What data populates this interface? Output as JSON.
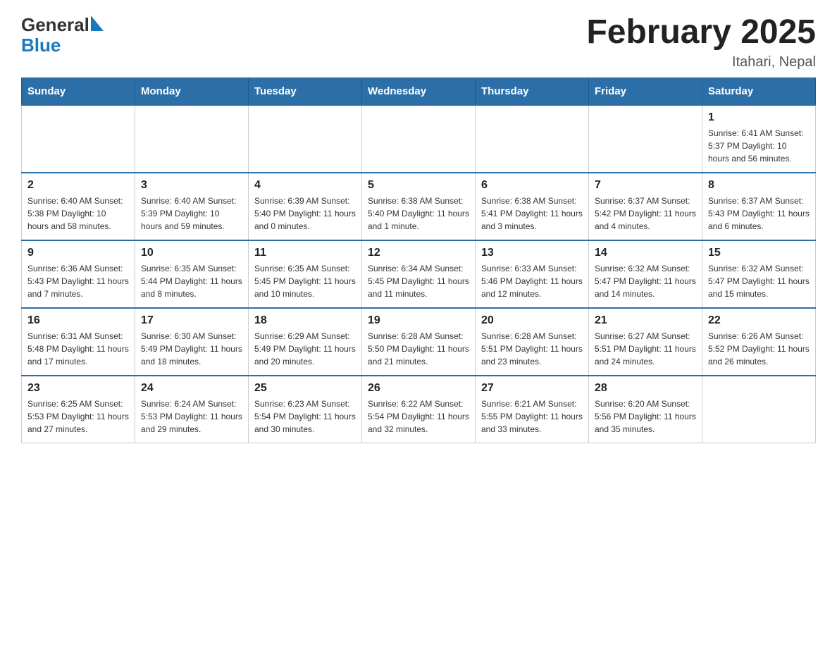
{
  "header": {
    "logo_general": "General",
    "logo_blue": "Blue",
    "title": "February 2025",
    "subtitle": "Itahari, Nepal"
  },
  "days_of_week": [
    "Sunday",
    "Monday",
    "Tuesday",
    "Wednesday",
    "Thursday",
    "Friday",
    "Saturday"
  ],
  "weeks": [
    [
      {
        "day": "",
        "info": ""
      },
      {
        "day": "",
        "info": ""
      },
      {
        "day": "",
        "info": ""
      },
      {
        "day": "",
        "info": ""
      },
      {
        "day": "",
        "info": ""
      },
      {
        "day": "",
        "info": ""
      },
      {
        "day": "1",
        "info": "Sunrise: 6:41 AM\nSunset: 5:37 PM\nDaylight: 10 hours\nand 56 minutes."
      }
    ],
    [
      {
        "day": "2",
        "info": "Sunrise: 6:40 AM\nSunset: 5:38 PM\nDaylight: 10 hours\nand 58 minutes."
      },
      {
        "day": "3",
        "info": "Sunrise: 6:40 AM\nSunset: 5:39 PM\nDaylight: 10 hours\nand 59 minutes."
      },
      {
        "day": "4",
        "info": "Sunrise: 6:39 AM\nSunset: 5:40 PM\nDaylight: 11 hours\nand 0 minutes."
      },
      {
        "day": "5",
        "info": "Sunrise: 6:38 AM\nSunset: 5:40 PM\nDaylight: 11 hours\nand 1 minute."
      },
      {
        "day": "6",
        "info": "Sunrise: 6:38 AM\nSunset: 5:41 PM\nDaylight: 11 hours\nand 3 minutes."
      },
      {
        "day": "7",
        "info": "Sunrise: 6:37 AM\nSunset: 5:42 PM\nDaylight: 11 hours\nand 4 minutes."
      },
      {
        "day": "8",
        "info": "Sunrise: 6:37 AM\nSunset: 5:43 PM\nDaylight: 11 hours\nand 6 minutes."
      }
    ],
    [
      {
        "day": "9",
        "info": "Sunrise: 6:36 AM\nSunset: 5:43 PM\nDaylight: 11 hours\nand 7 minutes."
      },
      {
        "day": "10",
        "info": "Sunrise: 6:35 AM\nSunset: 5:44 PM\nDaylight: 11 hours\nand 8 minutes."
      },
      {
        "day": "11",
        "info": "Sunrise: 6:35 AM\nSunset: 5:45 PM\nDaylight: 11 hours\nand 10 minutes."
      },
      {
        "day": "12",
        "info": "Sunrise: 6:34 AM\nSunset: 5:45 PM\nDaylight: 11 hours\nand 11 minutes."
      },
      {
        "day": "13",
        "info": "Sunrise: 6:33 AM\nSunset: 5:46 PM\nDaylight: 11 hours\nand 12 minutes."
      },
      {
        "day": "14",
        "info": "Sunrise: 6:32 AM\nSunset: 5:47 PM\nDaylight: 11 hours\nand 14 minutes."
      },
      {
        "day": "15",
        "info": "Sunrise: 6:32 AM\nSunset: 5:47 PM\nDaylight: 11 hours\nand 15 minutes."
      }
    ],
    [
      {
        "day": "16",
        "info": "Sunrise: 6:31 AM\nSunset: 5:48 PM\nDaylight: 11 hours\nand 17 minutes."
      },
      {
        "day": "17",
        "info": "Sunrise: 6:30 AM\nSunset: 5:49 PM\nDaylight: 11 hours\nand 18 minutes."
      },
      {
        "day": "18",
        "info": "Sunrise: 6:29 AM\nSunset: 5:49 PM\nDaylight: 11 hours\nand 20 minutes."
      },
      {
        "day": "19",
        "info": "Sunrise: 6:28 AM\nSunset: 5:50 PM\nDaylight: 11 hours\nand 21 minutes."
      },
      {
        "day": "20",
        "info": "Sunrise: 6:28 AM\nSunset: 5:51 PM\nDaylight: 11 hours\nand 23 minutes."
      },
      {
        "day": "21",
        "info": "Sunrise: 6:27 AM\nSunset: 5:51 PM\nDaylight: 11 hours\nand 24 minutes."
      },
      {
        "day": "22",
        "info": "Sunrise: 6:26 AM\nSunset: 5:52 PM\nDaylight: 11 hours\nand 26 minutes."
      }
    ],
    [
      {
        "day": "23",
        "info": "Sunrise: 6:25 AM\nSunset: 5:53 PM\nDaylight: 11 hours\nand 27 minutes."
      },
      {
        "day": "24",
        "info": "Sunrise: 6:24 AM\nSunset: 5:53 PM\nDaylight: 11 hours\nand 29 minutes."
      },
      {
        "day": "25",
        "info": "Sunrise: 6:23 AM\nSunset: 5:54 PM\nDaylight: 11 hours\nand 30 minutes."
      },
      {
        "day": "26",
        "info": "Sunrise: 6:22 AM\nSunset: 5:54 PM\nDaylight: 11 hours\nand 32 minutes."
      },
      {
        "day": "27",
        "info": "Sunrise: 6:21 AM\nSunset: 5:55 PM\nDaylight: 11 hours\nand 33 minutes."
      },
      {
        "day": "28",
        "info": "Sunrise: 6:20 AM\nSunset: 5:56 PM\nDaylight: 11 hours\nand 35 minutes."
      },
      {
        "day": "",
        "info": ""
      }
    ]
  ]
}
